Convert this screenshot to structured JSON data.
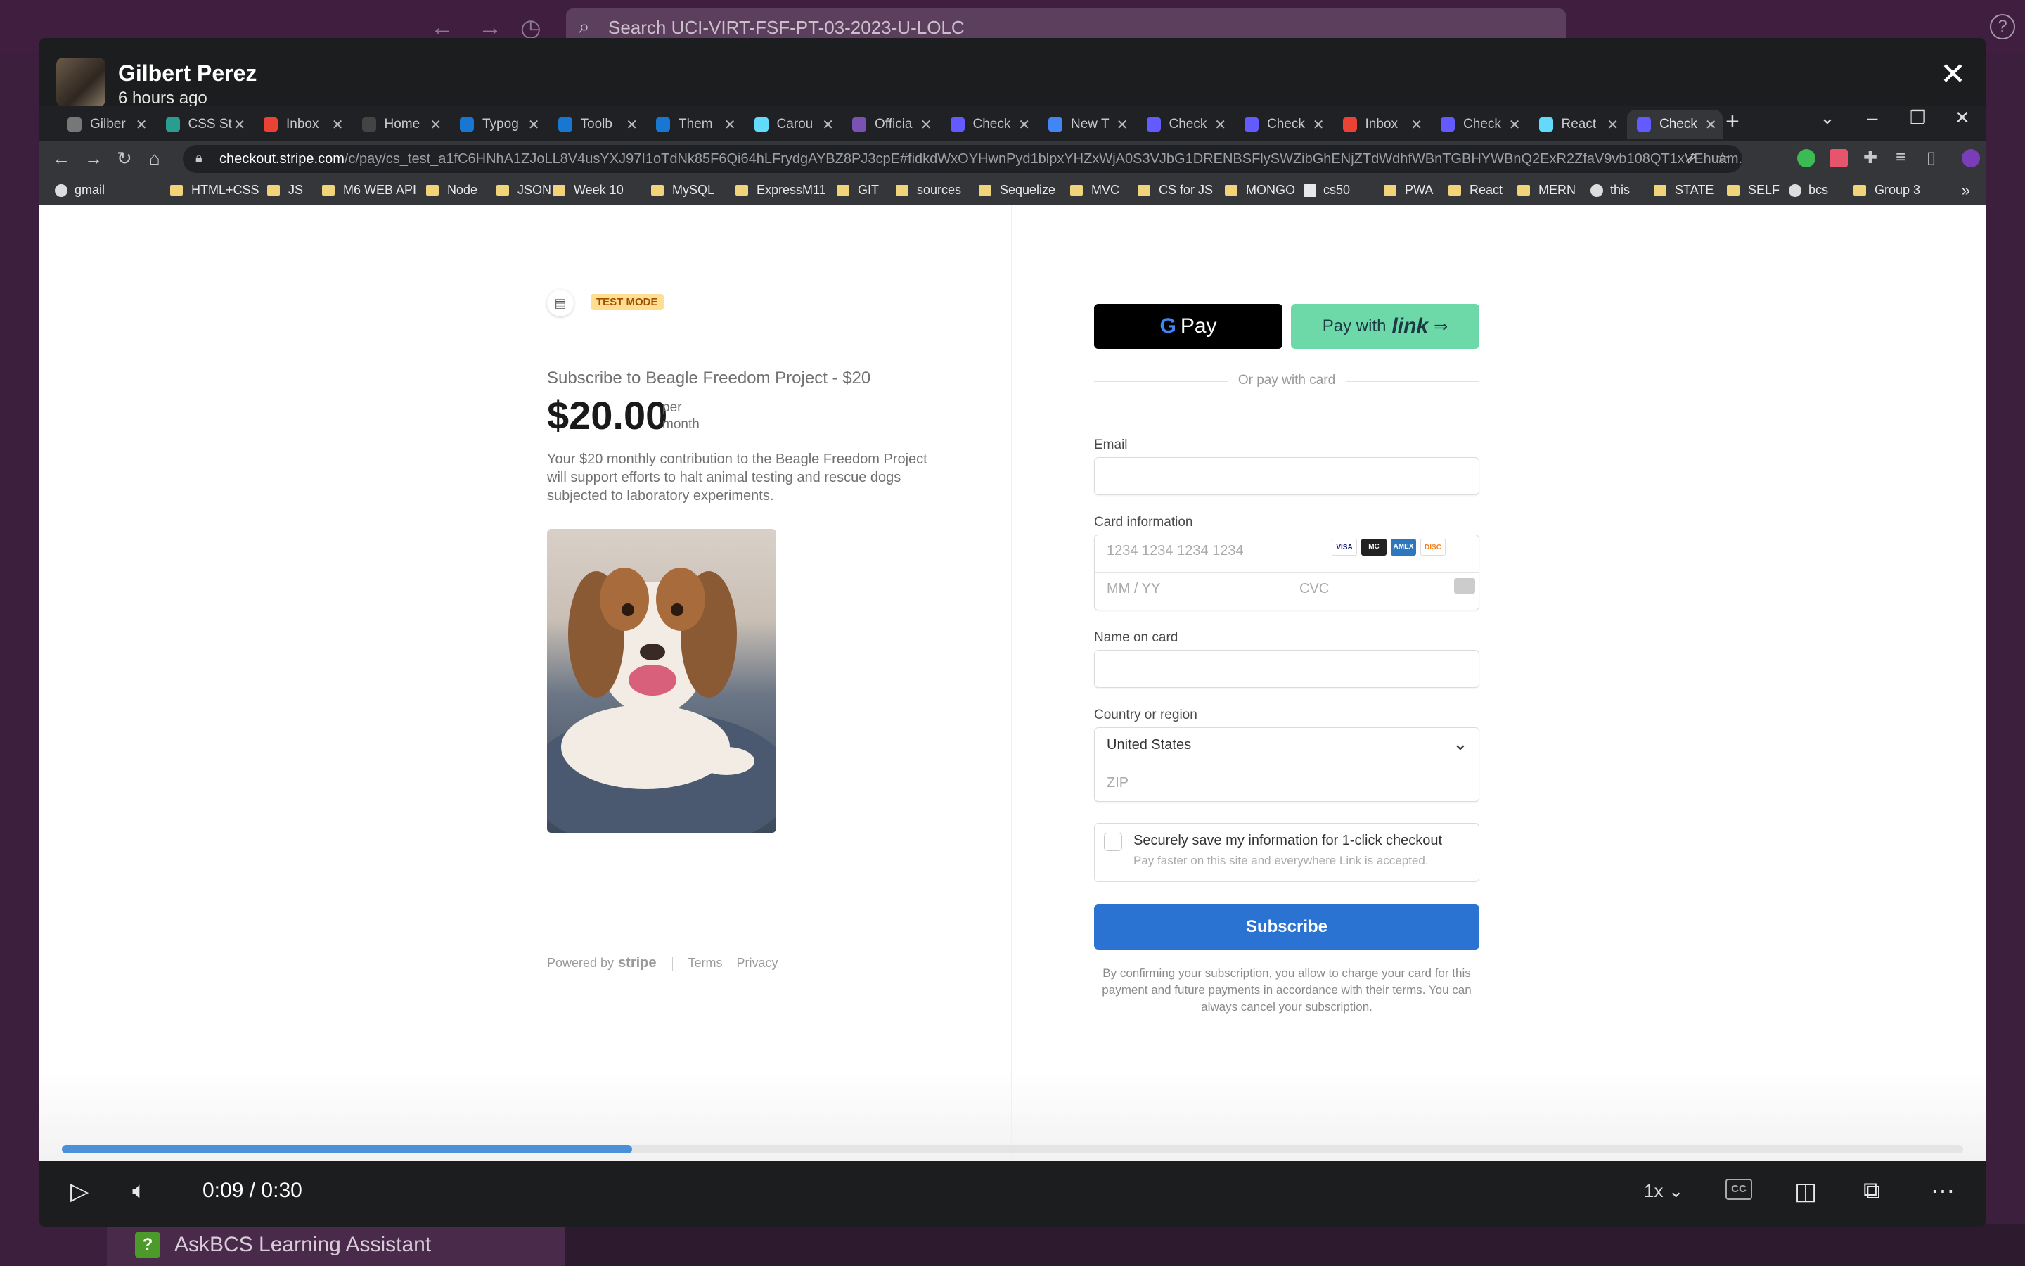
{
  "slack": {
    "search_placeholder": "Search UCI-VIRT-FSF-PT-03-2023-U-LOLC",
    "help": "?",
    "bottom_item": "AskBCS Learning Assistant"
  },
  "lightbox": {
    "author": "Gilbert Perez",
    "time_ago": "6 hours ago"
  },
  "browser": {
    "tabs": [
      {
        "label": "Gilber",
        "icon": "globe-icon"
      },
      {
        "label": "CSS St",
        "icon": "css-icon"
      },
      {
        "label": "Inbox",
        "icon": "gmail-icon"
      },
      {
        "label": "Home",
        "icon": "github-icon"
      },
      {
        "label": "Typog",
        "icon": "mui-icon"
      },
      {
        "label": "Toolb",
        "icon": "mui-icon"
      },
      {
        "label": "Them",
        "icon": "mui-icon"
      },
      {
        "label": "Carou",
        "icon": "react-icon"
      },
      {
        "label": "Officia",
        "icon": "bootstrap-icon"
      },
      {
        "label": "Check",
        "icon": "stripe-icon"
      },
      {
        "label": "New T",
        "icon": "chrome-icon"
      },
      {
        "label": "Check",
        "icon": "stripe-icon"
      },
      {
        "label": "Check",
        "icon": "stripe-icon"
      },
      {
        "label": "Inbox",
        "icon": "gmail-icon"
      },
      {
        "label": "Check",
        "icon": "stripe-icon"
      },
      {
        "label": "React",
        "icon": "react-icon"
      },
      {
        "label": "Check",
        "icon": "stripe-icon"
      }
    ],
    "url_host": "checkout.stripe.com",
    "url_path": "/c/pay/cs_test_a1fC6HNhA1ZJoLL8V4usYXJ97I1oTdNk85F6Qi64hLFrydgAYBZ8PJ3cpE#fidkdWxOYHwnPyd1blpxYHZxWjA0S3VJbG1DRENBSFlySWZibGhENjZTdWdhfWBnTGBHYWBnQ2ExR2ZfaV9vb108QT1xVEhuam...",
    "bookmarks": [
      "gmail",
      "HTML+CSS",
      "JS",
      "M6 WEB API",
      "Node",
      "JSON",
      "Week 10",
      "MySQL",
      "ExpressM11",
      "GIT",
      "sources",
      "Sequelize",
      "MVC",
      "CS for JS",
      "MONGO",
      "cs50",
      "PWA",
      "React",
      "MERN",
      "this",
      "STATE",
      "SELF",
      "bcs",
      "Group 3"
    ],
    "bookmarks_more": "»"
  },
  "checkout": {
    "test_mode": "TEST MODE",
    "product_name": "Subscribe to Beagle Freedom Project - $20",
    "price": "$20.00",
    "per_line1": "per",
    "per_line2": "month",
    "description": "Your $20 monthly contribution to the Beagle Freedom Project will support efforts to halt animal testing and rescue dogs subjected to laboratory experiments.",
    "powered_by": "Powered by",
    "stripe": "stripe",
    "terms": "Terms",
    "privacy": "Privacy",
    "gpay_label": "Pay",
    "link_pay_prefix": "Pay with",
    "link_word": "link",
    "or_pay": "Or pay with card",
    "email_label": "Email",
    "card_label": "Card information",
    "card_placeholder": "1234 1234 1234 1234",
    "expiry_placeholder": "MM / YY",
    "cvc_placeholder": "CVC",
    "card_brands": [
      "VISA",
      "MC",
      "AMEX",
      "DISC"
    ],
    "name_label": "Name on card",
    "country_label": "Country or region",
    "country_value": "United States",
    "zip_placeholder": "ZIP",
    "save_title": "Securely save my information for 1-click checkout",
    "save_sub": "Pay faster on this site and everywhere Link is accepted.",
    "subscribe": "Subscribe",
    "fine_print": "By confirming your subscription, you allow to charge your card for this payment and future payments in accordance with their terms. You can always cancel your subscription."
  },
  "video": {
    "current": "0:09",
    "separator": "/",
    "duration": "0:30",
    "progress_fraction": 0.3,
    "speed": "1x",
    "cc": "CC"
  },
  "colors": {
    "slack_bg": "#3f1e40",
    "stripe_button": "#2a73d2",
    "test_badge": "#ffde92",
    "link_button": "#6ed9a8"
  }
}
